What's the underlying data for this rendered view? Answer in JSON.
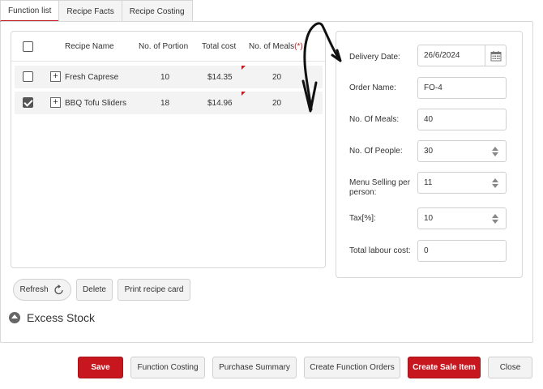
{
  "tabs": [
    {
      "label": "Function list",
      "active": true
    },
    {
      "label": "Recipe Facts",
      "active": false
    },
    {
      "label": "Recipe Costing",
      "active": false
    }
  ],
  "grid": {
    "headers": {
      "name": "Recipe Name",
      "portion": "No. of Portion",
      "cost": "Total cost",
      "meals": "No. of Meals",
      "meals_required": "(*)"
    },
    "rows": [
      {
        "checked": false,
        "expander": "+",
        "name": "Fresh Caprese",
        "portion": "10",
        "cost": "$14.35",
        "meals": "20"
      },
      {
        "checked": true,
        "expander": "+",
        "name": "BBQ Tofu Sliders",
        "portion": "18",
        "cost": "$14.96",
        "meals": "20"
      }
    ]
  },
  "grid_actions": {
    "refresh": "Refresh",
    "delete": "Delete",
    "print": "Print recipe card"
  },
  "excess_stock": {
    "title": "Excess Stock"
  },
  "form": {
    "delivery_date": {
      "label": "Delivery Date:",
      "value": "26/6/2024"
    },
    "order_name": {
      "label": "Order Name:",
      "value": "FO-4"
    },
    "no_of_meals": {
      "label": "No. Of Meals:",
      "value": "40"
    },
    "no_of_people": {
      "label": "No. Of People:",
      "value": "30"
    },
    "menu_selling": {
      "label": "Menu Selling per person:",
      "value": "11"
    },
    "tax": {
      "label": "Tax[%]:",
      "value": "10"
    },
    "labour_cost": {
      "label": "Total labour cost:",
      "value": "0"
    }
  },
  "footer": {
    "save": "Save",
    "function_costing": "Function Costing",
    "purchase_summary": "Purchase Summary",
    "create_function_orders": "Create Function Orders",
    "create_sale_item": "Create Sale Item",
    "close": "Close"
  },
  "colors": {
    "accent": "#c8161e",
    "border": "#d8d8d8",
    "row_bg": "#f3f3f3"
  }
}
